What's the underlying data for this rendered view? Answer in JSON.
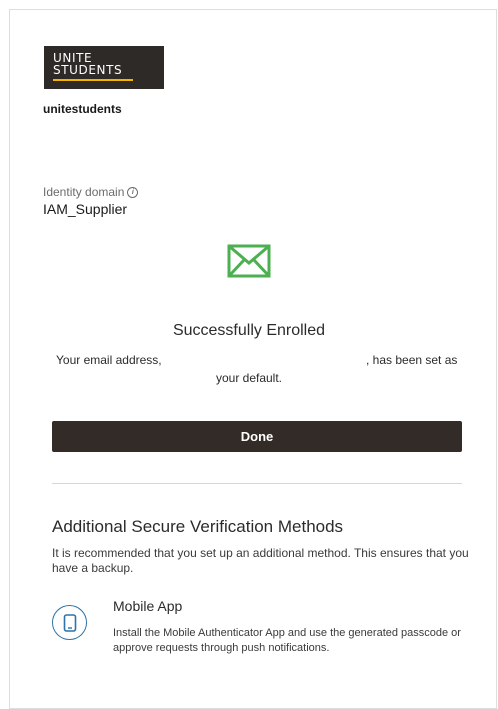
{
  "logo": {
    "line1": "UNITE",
    "line2": "STUDENTS"
  },
  "tenant": "unitestudents",
  "identity_domain": {
    "label": "Identity domain",
    "value": "IAM_Supplier"
  },
  "success": {
    "title": "Successfully Enrolled",
    "message_pre": "Your email address,",
    "message_post": ", has been set as",
    "message_line2": "your default."
  },
  "done_label": "Done",
  "additional": {
    "title": "Additional Secure Verification Methods",
    "description": "It is recommended that you set up an additional method. This ensures that you have a backup.",
    "methods": [
      {
        "name": "Mobile App",
        "description": "Install the Mobile Authenticator App and use the generated passcode or approve requests through push notifications."
      }
    ]
  },
  "colors": {
    "accent_green": "#4caf50",
    "button_dark": "#332b27",
    "icon_blue": "#2b73a8",
    "logo_underline": "#f4b400"
  }
}
